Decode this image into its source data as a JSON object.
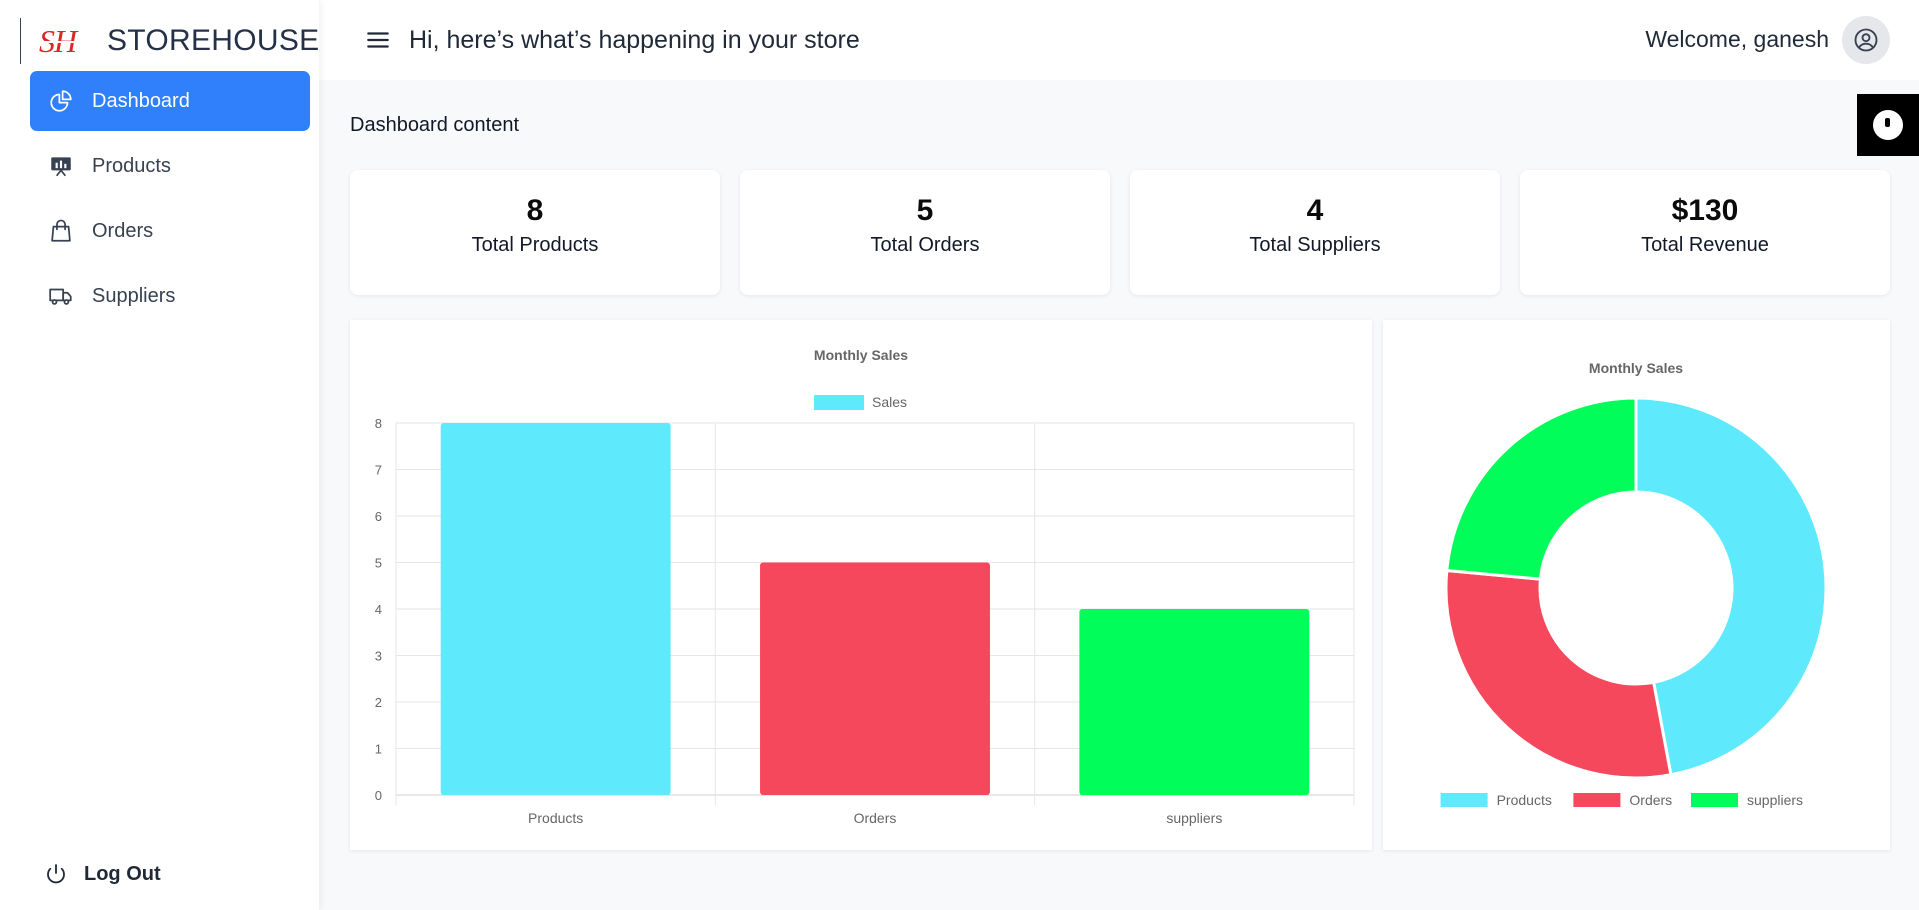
{
  "brand": {
    "logo": "SH",
    "name": "STOREHOUSE"
  },
  "sidebar": {
    "items": [
      {
        "label": "Dashboard",
        "icon": "pie-chart-icon",
        "active": true
      },
      {
        "label": "Products",
        "icon": "presentation-icon",
        "active": false
      },
      {
        "label": "Orders",
        "icon": "shopping-bag-icon",
        "active": false
      },
      {
        "label": "Suppliers",
        "icon": "truck-icon",
        "active": false
      }
    ],
    "logout_label": "Log Out"
  },
  "header": {
    "greeting": "Hi, here’s what’s happening in your store",
    "welcome": "Welcome, ganesh"
  },
  "content": {
    "title": "Dashboard content"
  },
  "stats": [
    {
      "value": "8",
      "label": "Total Products"
    },
    {
      "value": "5",
      "label": "Total Orders"
    },
    {
      "value": "4",
      "label": "Total Suppliers"
    },
    {
      "value": "$130",
      "label": "Total Revenue"
    }
  ],
  "colors": {
    "accent": "#2f80fa",
    "cyan": "#5eeafc",
    "red": "#f5485d",
    "green": "#00fd5a"
  },
  "chart_data": [
    {
      "type": "bar",
      "title": "Monthly Sales",
      "categories": [
        "Products",
        "Orders",
        "suppliers"
      ],
      "series": [
        {
          "name": "Sales",
          "values": [
            8,
            5,
            4
          ]
        }
      ],
      "bar_colors": [
        "#5eeafc",
        "#f5485d",
        "#00fd5a"
      ],
      "legend_color": "#5eeafc",
      "ylim": [
        0,
        8
      ],
      "yticks": [
        "0",
        "1",
        "2",
        "3",
        "4",
        "5",
        "6",
        "7",
        "8"
      ],
      "grid": true,
      "legend": "top"
    },
    {
      "type": "pie",
      "variant": "doughnut",
      "title": "Monthly Sales",
      "categories": [
        "Products",
        "Orders",
        "suppliers"
      ],
      "values": [
        8,
        5,
        4
      ],
      "colors": [
        "#5eeafc",
        "#f5485d",
        "#00fd5a"
      ],
      "legend": "bottom"
    }
  ]
}
